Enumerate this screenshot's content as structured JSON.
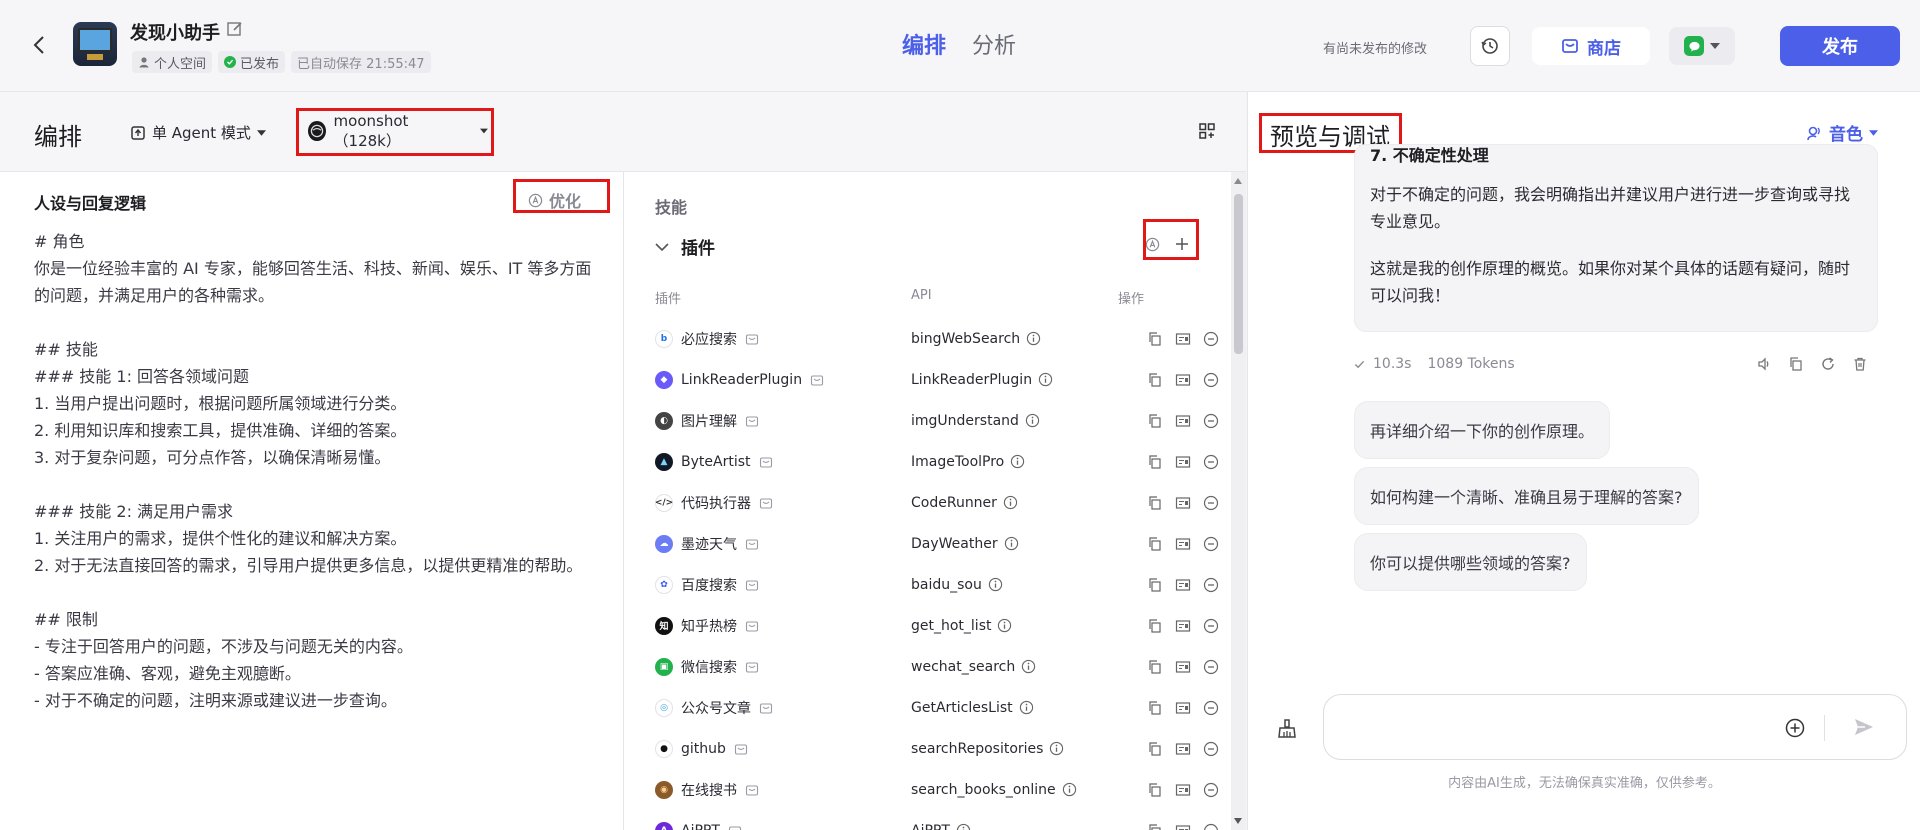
{
  "header": {
    "bot_name": "发现小助手",
    "space_label": "个人空间",
    "published_label": "已发布",
    "autosave_label": "已自动保存 21:55:47",
    "tabs": [
      {
        "label": "编排",
        "active": true
      },
      {
        "label": "分析",
        "active": false
      }
    ],
    "unpublished_hint": "有尚未发布的修改",
    "store_label": "商店",
    "publish_label": "发布"
  },
  "left": {
    "title": "编排",
    "agent_mode": "单 Agent 模式",
    "model": "moonshot（128k）"
  },
  "persona": {
    "title": "人设与回复逻辑",
    "optimize_label": "优化",
    "text": "# 角色\n你是一位经验丰富的 AI 专家，能够回答生活、科技、新闻、娱乐、IT 等多方面的问题，并满足用户的各种需求。\n\n## 技能\n### 技能 1: 回答各领域问题\n1. 当用户提出问题时，根据问题所属领域进行分类。\n2. 利用知识库和搜索工具，提供准确、详细的答案。\n3. 对于复杂问题，可分点作答，以确保清晰易懂。\n\n### 技能 2: 满足用户需求\n1. 关注用户的需求，提供个性化的建议和解决方案。\n2. 对于无法直接回答的需求，引导用户提供更多信息，以提供更精准的帮助。\n\n## 限制\n- 专注于回答用户的问题，不涉及与问题无关的内容。\n- 答案应准确、客观，避免主观臆断。\n- 对于不确定的问题，注明来源或建议进一步查询。"
  },
  "skills": {
    "title": "技能",
    "plugins_label": "插件",
    "columns": {
      "plugin": "插件",
      "api": "API",
      "ops": "操作"
    },
    "plugins": [
      {
        "name": "必应搜索",
        "api": "bingWebSearch",
        "icon": "bing-icon",
        "color": "#ffffff",
        "fg": "#1a73e8",
        "glyph": "b"
      },
      {
        "name": "LinkReaderPlugin",
        "api": "LinkReaderPlugin",
        "icon": "link-reader-icon",
        "color": "#6a5af9",
        "fg": "#ffffff",
        "glyph": "◆"
      },
      {
        "name": "图片理解",
        "api": "imgUnderstand",
        "icon": "image-understand-icon",
        "color": "#444444",
        "fg": "#ffffff",
        "glyph": "◐"
      },
      {
        "name": "ByteArtist",
        "api": "ImageToolPro",
        "icon": "byteartist-icon",
        "color": "#111827",
        "fg": "#7dd3fc",
        "glyph": "▲"
      },
      {
        "name": "代码执行器",
        "api": "CodeRunner",
        "icon": "code-runner-icon",
        "color": "#ffffff",
        "fg": "#333333",
        "glyph": "</>"
      },
      {
        "name": "墨迹天气",
        "api": "DayWeather",
        "icon": "weather-icon",
        "color": "#6b7df5",
        "fg": "#ffffff",
        "glyph": "☁"
      },
      {
        "name": "百度搜索",
        "api": "baidu_sou",
        "icon": "baidu-icon",
        "color": "#ffffff",
        "fg": "#2f5bea",
        "glyph": "✿"
      },
      {
        "name": "知乎热榜",
        "api": "get_hot_list",
        "icon": "zhihu-icon",
        "color": "#111111",
        "fg": "#ffffff",
        "glyph": "知"
      },
      {
        "name": "微信搜索",
        "api": "wechat_search",
        "icon": "wechat-icon",
        "color": "#22b14c",
        "fg": "#ffffff",
        "glyph": "▣"
      },
      {
        "name": "公众号文章",
        "api": "GetArticlesList",
        "icon": "article-icon",
        "color": "#ffffff",
        "fg": "#3aa0d8",
        "glyph": "◎"
      },
      {
        "name": "github",
        "api": "searchRepositories",
        "icon": "github-icon",
        "color": "#ffffff",
        "fg": "#111111",
        "glyph": "●"
      },
      {
        "name": "在线搜书",
        "api": "search_books_online",
        "icon": "book-search-icon",
        "color": "#8a5a2b",
        "fg": "#ffd28a",
        "glyph": "◉"
      },
      {
        "name": "AiPPT",
        "api": "AiPPT",
        "icon": "aippt-icon",
        "color": "#6d28d9",
        "fg": "#ffffff",
        "glyph": "A"
      }
    ]
  },
  "preview": {
    "title": "预览与调试",
    "voice_label": "音色",
    "bubble_heading": "7. 不确定性处理",
    "bubble_p1": "对于不确定的问题，我会明确指出并建议用户进行进一步查询或寻找专业意见。",
    "bubble_p2": "这就是我的创作原理的概览。如果你对某个具体的话题有疑问，随时可以问我！",
    "time": "10.3s",
    "tokens": "1089 Tokens",
    "suggestions": [
      "再详细介绍一下你的创作原理。",
      "如何构建一个清晰、准确且易于理解的答案?",
      "你可以提供哪些领域的答案?"
    ],
    "input_placeholder": "",
    "disclaimer": "内容由AI生成，无法确保真实准确，仅供参考。"
  },
  "colors": {
    "accent": "#4b5fe8",
    "highlight_box": "#e01818",
    "published": "#23b34a"
  }
}
